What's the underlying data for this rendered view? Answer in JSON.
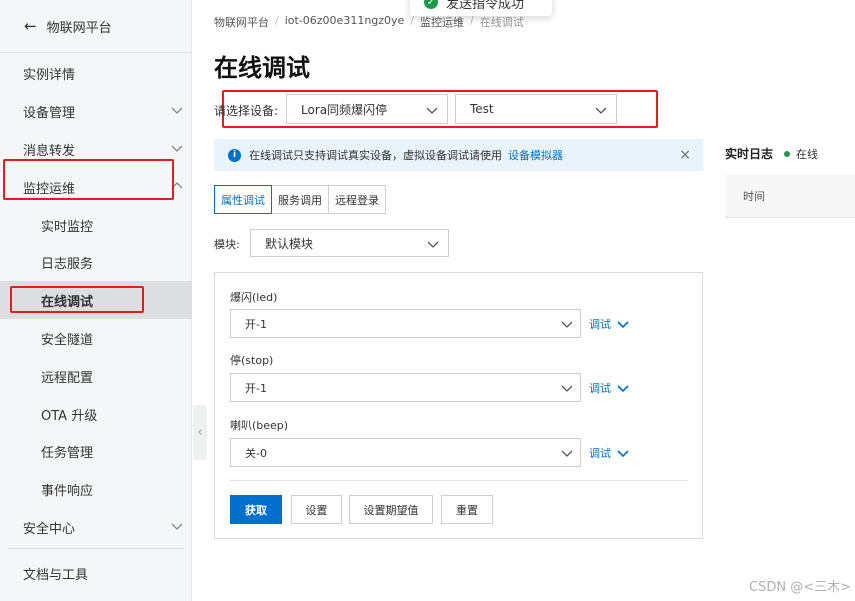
{
  "sidebar": {
    "back_label": "物联网平台",
    "items": [
      {
        "label": "实例详情"
      },
      {
        "label": "设备管理"
      },
      {
        "label": "消息转发"
      },
      {
        "label": "监控运维"
      },
      {
        "label": "实时监控"
      },
      {
        "label": "日志服务"
      },
      {
        "label": "在线调试"
      },
      {
        "label": "安全隧道"
      },
      {
        "label": "远程配置"
      },
      {
        "label": "OTA 升级"
      },
      {
        "label": "任务管理"
      },
      {
        "label": "事件响应"
      },
      {
        "label": "安全中心"
      },
      {
        "label": "文档与工具"
      }
    ]
  },
  "toast": {
    "text": "发送指令成功"
  },
  "breadcrumb": [
    "物联网平台",
    "iot-06z00e311ngz0ye",
    "监控运维",
    "在线调试"
  ],
  "page_title": "在线调试",
  "device_select": {
    "label": "请选择设备:",
    "product": "Lora同频爆闪停",
    "device": "Test"
  },
  "alert": {
    "text": "在线调试只支持调试真实设备，虚拟设备调试请使用",
    "link": "设备模拟器",
    "close": "×"
  },
  "tabs": [
    "属性调试",
    "服务调用",
    "远程登录"
  ],
  "module": {
    "label": "模块:",
    "value": "默认模块"
  },
  "properties": [
    {
      "label": "爆闪(led)",
      "value": "开-1",
      "action": "调试"
    },
    {
      "label": "停(stop)",
      "value": "开-1",
      "action": "调试"
    },
    {
      "label": "喇叭(beep)",
      "value": "关-0",
      "action": "调试"
    }
  ],
  "buttons": {
    "get": "获取",
    "set": "设置",
    "set_expected": "设置期望值",
    "reset": "重置"
  },
  "log": {
    "title": "实时日志",
    "status": "在线",
    "column_time": "时间"
  },
  "watermark": "CSDN @<三木>",
  "colors": {
    "accent": "#0070cc",
    "online": "#1e9a4c",
    "highlight": "#e01e1e"
  }
}
